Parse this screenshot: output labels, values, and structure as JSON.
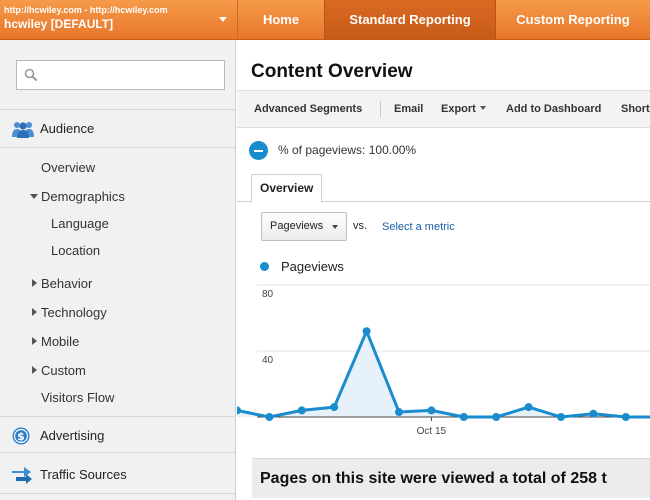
{
  "header": {
    "profile_url": "http://hcwiley.com - http://hcwiley.com",
    "profile_name": "hcwiley [DEFAULT]",
    "nav": {
      "home": "Home",
      "standard": "Standard Reporting",
      "custom": "Custom Reporting"
    }
  },
  "sidebar": {
    "search_placeholder": "",
    "audience": "Audience",
    "audience_items": {
      "overview": "Overview",
      "demographics": "Demographics",
      "language": "Language",
      "location": "Location",
      "behavior": "Behavior",
      "technology": "Technology",
      "mobile": "Mobile",
      "custom": "Custom",
      "visitors_flow": "Visitors Flow"
    },
    "advertising": "Advertising",
    "traffic_sources": "Traffic Sources"
  },
  "main": {
    "title": "Content Overview",
    "toolbar": {
      "advanced_segments": "Advanced Segments",
      "email": "Email",
      "export": "Export",
      "add_to_dashboard": "Add to Dashboard",
      "shortcut": "Short"
    },
    "segment_text": "% of pageviews: 100.00%",
    "tab": "Overview",
    "metric_select": "Pageviews",
    "vs": "vs.",
    "select_metric": "Select a metric",
    "legend": "Pageviews",
    "summary": "Pages on this site were viewed a total of 258 t"
  },
  "chart_data": {
    "type": "area",
    "series": [
      {
        "name": "Pageviews",
        "values": [
          4,
          0,
          4,
          6,
          52,
          3,
          4,
          0,
          0,
          6,
          0,
          2,
          0,
          0
        ]
      }
    ],
    "ylim": [
      0,
      80
    ],
    "yticks": [
      "80",
      "40"
    ],
    "xtick_labels": [
      {
        "index": 6,
        "label": "Oct 15"
      }
    ],
    "color": "#1a8ccd",
    "fill_color": "#e6f1f9"
  }
}
